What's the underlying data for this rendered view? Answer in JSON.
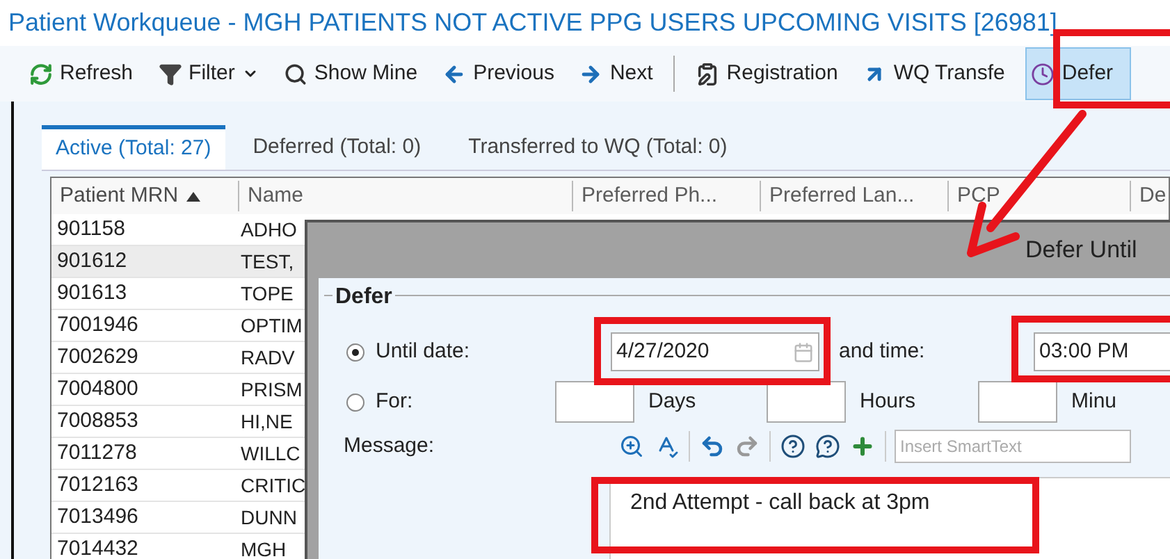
{
  "window": {
    "title": "Patient Workqueue - MGH PATIENTS NOT ACTIVE PPG USERS UPCOMING VISITS [26981]"
  },
  "toolbar": [
    {
      "kind": "refresh",
      "label": "Refresh",
      "dropdown": false,
      "active": false
    },
    {
      "kind": "filter",
      "label": "Filter",
      "dropdown": true,
      "active": false
    },
    {
      "kind": "search",
      "label": "Show Mine",
      "dropdown": false,
      "active": false
    },
    {
      "kind": "previous",
      "label": "Previous",
      "dropdown": false,
      "active": false
    },
    {
      "kind": "next",
      "label": "Next",
      "dropdown": false,
      "active": false
    },
    {
      "kind": "separator"
    },
    {
      "kind": "registration",
      "label": "Registration",
      "dropdown": false,
      "active": false
    },
    {
      "kind": "transfer",
      "label": "WQ Transfe",
      "dropdown": false,
      "active": false
    },
    {
      "kind": "defer",
      "label": "Defer",
      "dropdown": false,
      "active": true
    }
  ],
  "tabs": [
    {
      "label": "Active (Total: 27)",
      "selected": true
    },
    {
      "label": "Deferred (Total: 0)",
      "selected": false
    },
    {
      "label": "Transferred to WQ (Total: 0)",
      "selected": false
    }
  ],
  "table": {
    "columns": [
      {
        "label": "Patient MRN",
        "sorted": true
      },
      {
        "label": "Name",
        "sorted": false
      },
      {
        "label": "Preferred Ph...",
        "sorted": false
      },
      {
        "label": "Preferred Lan...",
        "sorted": false
      },
      {
        "label": "PCP",
        "sorted": false
      },
      {
        "label": "De",
        "sorted": false
      }
    ],
    "rows": [
      {
        "mrn": "901158",
        "name": "ADHO",
        "selected": false
      },
      {
        "mrn": "901612",
        "name": "TEST,",
        "selected": true
      },
      {
        "mrn": "901613",
        "name": "TOPE",
        "selected": false
      },
      {
        "mrn": "7001946",
        "name": "OPTIM",
        "selected": false
      },
      {
        "mrn": "7002629",
        "name": "RADV",
        "selected": false
      },
      {
        "mrn": "7004800",
        "name": "PRISM",
        "selected": false
      },
      {
        "mrn": "7008853",
        "name": "HI,NE",
        "selected": false
      },
      {
        "mrn": "7011278",
        "name": "WILLC",
        "selected": false
      },
      {
        "mrn": "7012163",
        "name": "CRITIC",
        "selected": false
      },
      {
        "mrn": "7013496",
        "name": "DUNN",
        "selected": false
      },
      {
        "mrn": "7014432",
        "name": "MGH",
        "selected": false
      }
    ]
  },
  "dialog": {
    "title": "Defer Until",
    "group": "Defer",
    "until": {
      "label": "Until date:",
      "selected": true,
      "date": "4/27/2020",
      "time_label": "and time:",
      "time": "03:00 PM"
    },
    "for": {
      "label": "For:",
      "selected": false,
      "units": [
        "Days",
        "Hours",
        "Minu"
      ]
    },
    "message": {
      "label": "Message:",
      "smarttext_placeholder": "Insert SmartText",
      "value": "2nd Attempt - call back at 3pm"
    }
  }
}
